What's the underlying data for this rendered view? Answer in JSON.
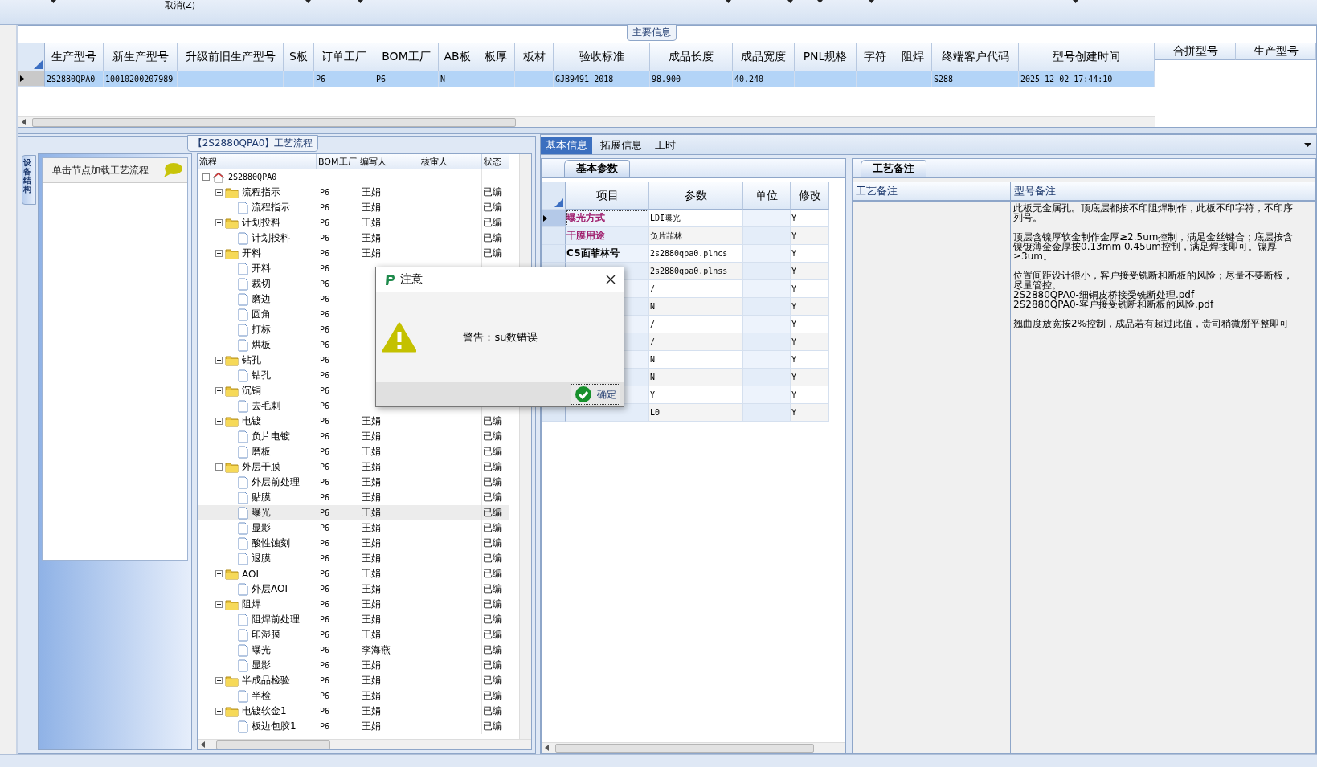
{
  "toolbar": {
    "cancel_label": "取消(Z)"
  },
  "main_info": {
    "title": "主要信息",
    "row_selected": true,
    "columns": [
      {
        "label": "生产型号",
        "value": "2S2880QPA0"
      },
      {
        "label": "新生产型号",
        "value": "10010200207989"
      },
      {
        "label": "升级前旧生产型号"
      },
      {
        "label": "S板"
      },
      {
        "label": "订单工厂",
        "value": "P6"
      },
      {
        "label": "BOM工厂",
        "value": "P6"
      },
      {
        "label": "AB板",
        "value": "N"
      },
      {
        "label": "板厚"
      },
      {
        "label": "板材"
      },
      {
        "label": "验收标准",
        "value": "GJB9491-2018"
      },
      {
        "label": "成品长度",
        "value": "98.900"
      },
      {
        "label": "成品宽度",
        "value": "40.240"
      },
      {
        "label": "PNL规格"
      },
      {
        "label": "字符"
      },
      {
        "label": "阻焊"
      },
      {
        "label": "终端客户代码",
        "value": "S288"
      },
      {
        "label": "型号创建时间",
        "value": "2025-12-02 17:44:10"
      }
    ]
  },
  "merge_grid": {
    "columns": [
      "合拼型号",
      "生产型号"
    ]
  },
  "process": {
    "title": "【2S2880QPA0】工艺流程",
    "side_tab": "设备结构",
    "hint": "单击节点加载工艺流程",
    "columns": [
      "流程",
      "BOM工厂",
      "编写人",
      "核审人",
      "状态"
    ],
    "tree": [
      {
        "label": "2S2880QPA0",
        "kind": "root",
        "expanded": true,
        "selected": false,
        "children": [
          {
            "label": "流程指示",
            "kind": "folder",
            "bom": "P6",
            "writer": "王娟",
            "status": "已编",
            "expanded": true,
            "selected": false,
            "children": [
              {
                "label": "流程指示",
                "kind": "file",
                "bom": "P6",
                "writer": "王娟",
                "status": "已编",
                "selected": false
              }
            ]
          },
          {
            "label": "计划投料",
            "kind": "folder",
            "bom": "P6",
            "writer": "王娟",
            "status": "已编",
            "expanded": true,
            "selected": false,
            "children": [
              {
                "label": "计划投料",
                "kind": "file",
                "bom": "P6",
                "writer": "王娟",
                "status": "已编",
                "selected": false
              }
            ]
          },
          {
            "label": "开料",
            "kind": "folder",
            "bom": "P6",
            "writer": "王娟",
            "status": "已编",
            "expanded": true,
            "selected": false,
            "children": [
              {
                "label": "开料",
                "kind": "file",
                "bom": "P6",
                "selected": false
              },
              {
                "label": "裁切",
                "kind": "file",
                "bom": "P6",
                "selected": false
              },
              {
                "label": "磨边",
                "kind": "file",
                "bom": "P6",
                "selected": false
              },
              {
                "label": "圆角",
                "kind": "file",
                "bom": "P6",
                "selected": false
              },
              {
                "label": "打标",
                "kind": "file",
                "bom": "P6",
                "selected": false
              },
              {
                "label": "烘板",
                "kind": "file",
                "bom": "P6",
                "selected": false
              }
            ]
          },
          {
            "label": "钻孔",
            "kind": "folder",
            "bom": "P6",
            "expanded": true,
            "selected": false,
            "children": [
              {
                "label": "钻孔",
                "kind": "file",
                "bom": "P6",
                "selected": false
              }
            ]
          },
          {
            "label": "沉铜",
            "kind": "folder",
            "bom": "P6",
            "expanded": true,
            "selected": false,
            "children": [
              {
                "label": "去毛刺",
                "kind": "file",
                "bom": "P6",
                "selected": false
              }
            ]
          },
          {
            "label": "电镀",
            "kind": "folder",
            "bom": "P6",
            "writer": "王娟",
            "status": "已编",
            "expanded": true,
            "selected": false,
            "children": [
              {
                "label": "负片电镀",
                "kind": "file",
                "bom": "P6",
                "writer": "王娟",
                "status": "已编",
                "selected": false
              },
              {
                "label": "磨板",
                "kind": "file",
                "bom": "P6",
                "writer": "王娟",
                "status": "已编",
                "selected": false
              }
            ]
          },
          {
            "label": "外层干膜",
            "kind": "folder",
            "bom": "P6",
            "writer": "王娟",
            "status": "已编",
            "expanded": true,
            "selected": false,
            "children": [
              {
                "label": "外层前处理",
                "kind": "file",
                "bom": "P6",
                "writer": "王娟",
                "status": "已编",
                "selected": false
              },
              {
                "label": "贴膜",
                "kind": "file",
                "bom": "P6",
                "writer": "王娟",
                "status": "已编",
                "selected": false
              },
              {
                "label": "曝光",
                "kind": "file",
                "bom": "P6",
                "writer": "王娟",
                "status": "已编",
                "selected": true
              },
              {
                "label": "显影",
                "kind": "file",
                "bom": "P6",
                "writer": "王娟",
                "status": "已编",
                "selected": false
              },
              {
                "label": "酸性蚀刻",
                "kind": "file",
                "bom": "P6",
                "writer": "王娟",
                "status": "已编",
                "selected": false
              },
              {
                "label": "退膜",
                "kind": "file",
                "bom": "P6",
                "writer": "王娟",
                "status": "已编",
                "selected": false
              }
            ]
          },
          {
            "label": "AOI",
            "kind": "folder",
            "bom": "P6",
            "writer": "王娟",
            "status": "已编",
            "expanded": true,
            "selected": false,
            "children": [
              {
                "label": "外层AOI",
                "kind": "file",
                "bom": "P6",
                "writer": "王娟",
                "status": "已编",
                "selected": false
              }
            ]
          },
          {
            "label": "阻焊",
            "kind": "folder",
            "bom": "P6",
            "writer": "王娟",
            "status": "已编",
            "expanded": true,
            "selected": false,
            "children": [
              {
                "label": "阻焊前处理",
                "kind": "file",
                "bom": "P6",
                "writer": "王娟",
                "status": "已编",
                "selected": false
              },
              {
                "label": "印湿膜",
                "kind": "file",
                "bom": "P6",
                "writer": "王娟",
                "status": "已编",
                "selected": false
              },
              {
                "label": "曝光",
                "kind": "file",
                "bom": "P6",
                "writer": "李海燕",
                "status": "已编",
                "selected": false
              },
              {
                "label": "显影",
                "kind": "file",
                "bom": "P6",
                "writer": "王娟",
                "status": "已编",
                "selected": false
              }
            ]
          },
          {
            "label": "半成品检验",
            "kind": "folder",
            "bom": "P6",
            "writer": "王娟",
            "status": "已编",
            "expanded": true,
            "selected": false,
            "children": [
              {
                "label": "半检",
                "kind": "file",
                "bom": "P6",
                "writer": "王娟",
                "status": "已编",
                "selected": false
              }
            ]
          },
          {
            "label": "电镀软金1",
            "kind": "folder",
            "bom": "P6",
            "writer": "王娟",
            "status": "已编",
            "expanded": true,
            "selected": false,
            "children": [
              {
                "label": "板边包胶1",
                "kind": "file",
                "bom": "P6",
                "writer": "王娟",
                "status": "已编",
                "selected": false
              }
            ]
          }
        ]
      }
    ]
  },
  "detail_tabs": [
    {
      "label": "基本信息",
      "selected": true
    },
    {
      "label": "拓展信息",
      "selected": false
    },
    {
      "label": "工时",
      "selected": false
    }
  ],
  "params": {
    "tab": "基本参数",
    "columns": [
      "项目",
      "参数",
      "单位",
      "修改"
    ],
    "rows": [
      {
        "item": "曝光方式",
        "color": "#a0206e",
        "value": "LDI曝光",
        "modify": "Y",
        "selected": true
      },
      {
        "item": "干膜用途",
        "color": "#a0206e",
        "value": "负片菲林",
        "modify": "Y",
        "selected": false
      },
      {
        "item": "CS面菲林号",
        "color": "#000000",
        "value": "2s2880qpa0.plncs",
        "modify": "Y",
        "selected": false
      },
      {
        "value": "2s2880qpa0.plnss",
        "modify": "Y",
        "selected": false
      },
      {
        "value": "/",
        "modify": "Y"
      },
      {
        "value": "N",
        "modify": "Y"
      },
      {
        "value": "/",
        "modify": "Y"
      },
      {
        "value": "/",
        "modify": "Y"
      },
      {
        "value": "N",
        "modify": "Y"
      },
      {
        "value": "N",
        "modify": "Y"
      },
      {
        "value": "Y",
        "modify": "Y"
      },
      {
        "value": "L0",
        "modify": "Y",
        "selected": false
      }
    ]
  },
  "remarks": {
    "tab": "工艺备注",
    "columns": [
      "工艺备注",
      "型号备注"
    ],
    "paragraphs": [
      "此板无金属孔。顶底层都按不印阻焊制作，此板不印字符，不印序列号。",
      "顶层含镍厚软金制作金厚≥2.5um控制，满足金丝键合；底层按含镍镀薄金金厚按0.13mm 0.45um控制，满足焊接即可。镍厚≥3um。",
      "位置间距设计很小，客户接受铣断和断板的风险；尽量不要断板，尽量管控。",
      "2S2880QPA0-细铜皮桥接受铣断处理.pdf",
      "2S2880QPA0-客户接受铣断和断板的风险.pdf",
      "翘曲度放宽按2%控制，成品若有超过此值，贵司稍微掰平整即可"
    ]
  },
  "dialog": {
    "title": "注意",
    "message": "警告：su数错误",
    "button": "确定"
  }
}
